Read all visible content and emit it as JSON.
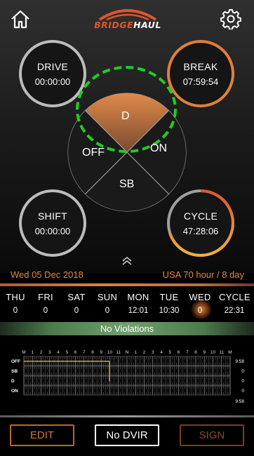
{
  "header": {
    "logo_part1": "BRIDGE",
    "logo_part2": "HAUL",
    "home_icon": "home-icon",
    "settings_icon": "gear-icon"
  },
  "gauges": {
    "drive": {
      "label": "DRIVE",
      "value": "00:00:00"
    },
    "break": {
      "label": "BREAK",
      "value": "07:59:54"
    },
    "shift": {
      "label": "SHIFT",
      "value": "00:00:00"
    },
    "cycle": {
      "label": "CYCLE",
      "value": "47:28:06"
    }
  },
  "status_wheel": {
    "selected": "D",
    "d": "D",
    "off": "OFF",
    "on": "ON",
    "sb": "SB"
  },
  "date_row": {
    "date": "Wed 05 Dec 2018",
    "rule": "USA 70 hour / 8 day"
  },
  "days": [
    {
      "name": "THU",
      "value": "0"
    },
    {
      "name": "FRI",
      "value": "0"
    },
    {
      "name": "SAT",
      "value": "0"
    },
    {
      "name": "SUN",
      "value": "0"
    },
    {
      "name": "MON",
      "value": "12:01"
    },
    {
      "name": "TUE",
      "value": "10:30"
    },
    {
      "name": "WED",
      "value": "0"
    },
    {
      "name": "CYCLE",
      "value": "22:31"
    }
  ],
  "violations": "No Violations",
  "log_graph": {
    "hours": [
      "M",
      "1",
      "2",
      "3",
      "4",
      "5",
      "6",
      "7",
      "8",
      "9",
      "10",
      "11",
      "N",
      "1",
      "2",
      "3",
      "4",
      "5",
      "6",
      "7",
      "8",
      "9",
      "10",
      "11",
      "M"
    ],
    "rows": [
      "OFF",
      "SB",
      "D",
      "ON"
    ],
    "totals": [
      "9:58",
      "0",
      "0",
      "0"
    ],
    "grand_total": "9:58"
  },
  "buttons": {
    "edit": "EDIT",
    "dvir": "No DVIR",
    "sign": "SIGN"
  },
  "colors": {
    "accent": "#e0803a",
    "violations_bar": "#6fa06c",
    "selection_ring": "#22cc22"
  }
}
